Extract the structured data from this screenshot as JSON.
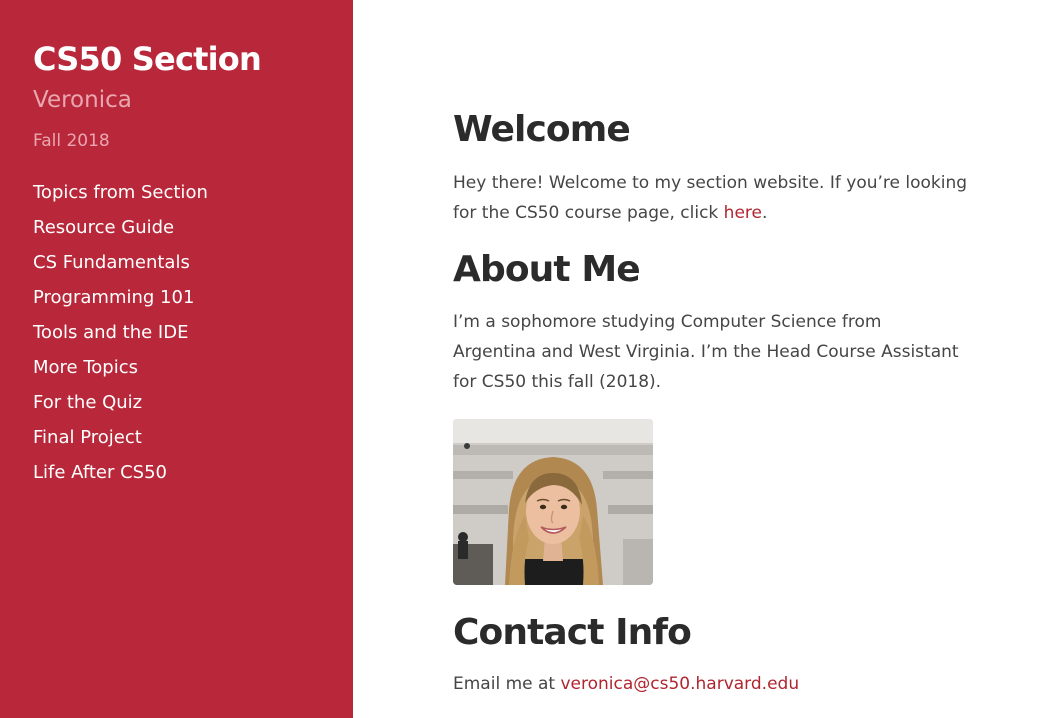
{
  "sidebar": {
    "title": "CS50 Section",
    "author": "Veronica",
    "term": "Fall 2018",
    "nav": [
      "Topics from Section",
      "Resource Guide",
      "CS Fundamentals",
      "Programming 101",
      "Tools and the IDE",
      "More Topics",
      "For the Quiz",
      "Final Project",
      "Life After CS50"
    ]
  },
  "welcome": {
    "heading": "Welcome",
    "text_before": "Hey there! Welcome to my section website. If you’re looking for the CS50 course page, click ",
    "link_text": "here",
    "text_after": "."
  },
  "about": {
    "heading": "About Me",
    "text": "I’m a sophomore studying Computer Science from Argentina and West Virginia. I’m the Head Course Assistant for CS50 this fall (2018)."
  },
  "contact": {
    "heading": "Contact Info",
    "text_before": "Email me at ",
    "email": "veronica@cs50.harvard.edu"
  },
  "colors": {
    "sidebar_bg": "#b8283a",
    "sidebar_muted_text": "#e9a6b0",
    "link": "#b0252f",
    "heading": "#2b2b2b",
    "body_text": "#454545"
  }
}
